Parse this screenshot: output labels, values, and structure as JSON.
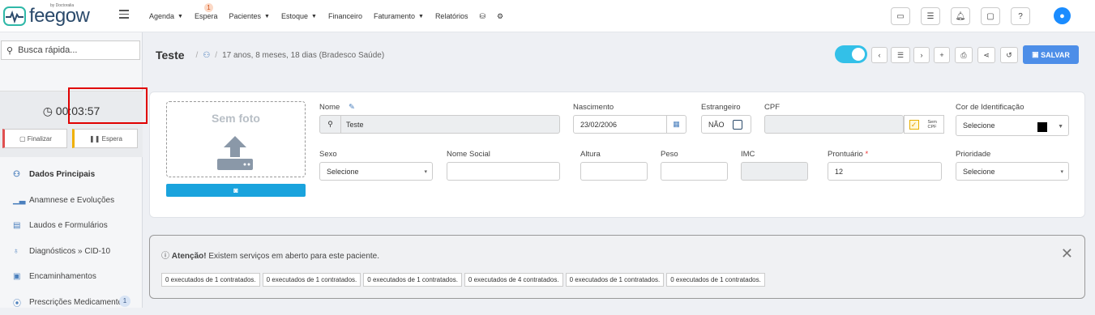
{
  "logo": {
    "text": "feegow",
    "by": "by Doctoralia"
  },
  "nav": [
    {
      "label": "Agenda",
      "caret": true
    },
    {
      "label": "Espera",
      "caret": false,
      "badge": "1"
    },
    {
      "label": "Pacientes",
      "caret": true
    },
    {
      "label": "Estoque",
      "caret": true
    },
    {
      "label": "Financeiro",
      "caret": false
    },
    {
      "label": "Faturamento",
      "caret": true
    },
    {
      "label": "Relatórios",
      "caret": false
    }
  ],
  "sidebar": {
    "search_placeholder": "Busca rápida...",
    "timer": "00:03:57",
    "finalizar": "Finalizar",
    "espera": "Espera",
    "items": [
      {
        "label": "Dados Principais",
        "icon": "user-icon"
      },
      {
        "label": "Anamnese e Evoluções",
        "icon": "chart-icon"
      },
      {
        "label": "Laudos e Formulários",
        "icon": "clipboard-icon"
      },
      {
        "label": "Diagnósticos » CID-10",
        "icon": "stethoscope-icon"
      },
      {
        "label": "Encaminhamentos",
        "icon": "document-icon"
      },
      {
        "label": "Prescrições Medicamentos",
        "icon": "pills-icon",
        "badge": "1"
      }
    ]
  },
  "header": {
    "title": "Teste",
    "subtitle": "17 anos, 8 meses, 18 dias (Bradesco Saúde)",
    "save": "SALVAR"
  },
  "form": {
    "photo_label": "Sem foto",
    "nome_label": "Nome",
    "nome_value": "Teste",
    "nascimento_label": "Nascimento",
    "nascimento_value": "23/02/2006",
    "estrangeiro_label": "Estrangeiro",
    "estrangeiro_value": "NÃO",
    "cpf_label": "CPF",
    "sem_cpf": "Sem CPF",
    "cor_label": "Cor de Identificação",
    "cor_value": "Selecione",
    "sexo_label": "Sexo",
    "sexo_value": "Selecione",
    "nome_social_label": "Nome Social",
    "altura_label": "Altura",
    "peso_label": "Peso",
    "imc_label": "IMC",
    "prontuario_label": "Prontuário",
    "prontuario_value": "12",
    "prioridade_label": "Prioridade",
    "prioridade_value": "Selecione"
  },
  "alert": {
    "strong": "Atenção!",
    "text": " Existem serviços em aberto para este paciente.",
    "chips": [
      "0 executados de 1 contratados.",
      "0 executados de 1 contratados.",
      "0 executados de 1 contratados.",
      "0 executados de 4 contratados.",
      "0 executados de 1 contratados.",
      "0 executados de 1 contratados."
    ]
  }
}
